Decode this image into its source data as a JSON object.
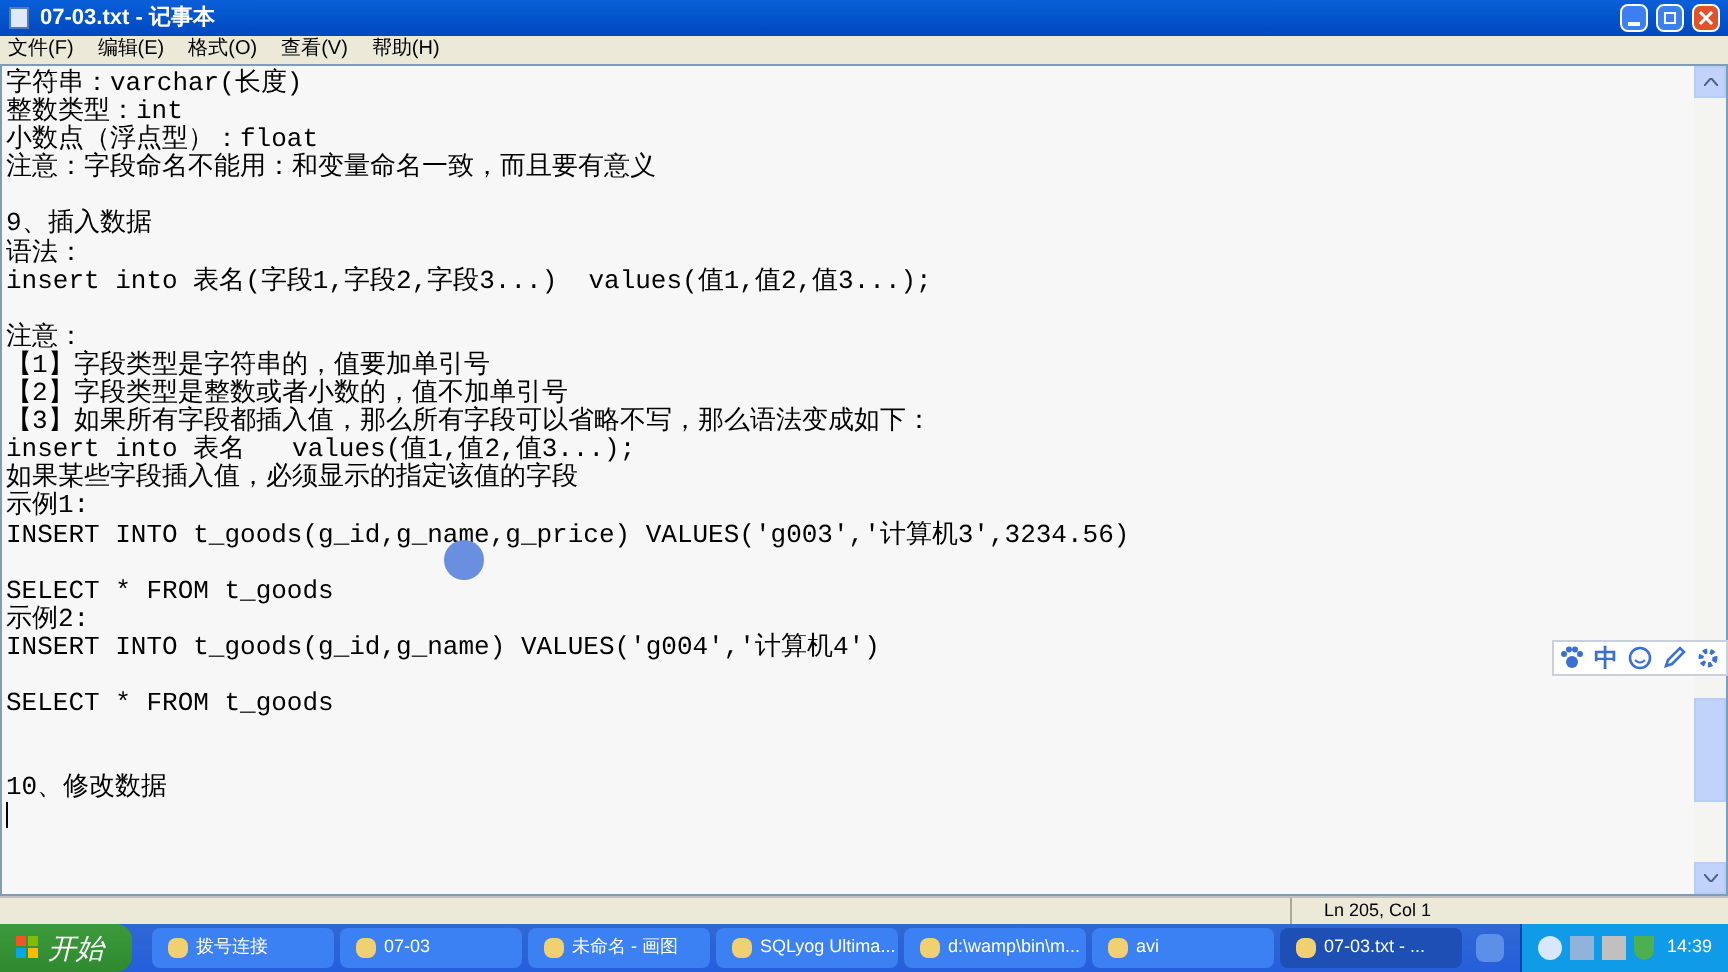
{
  "window": {
    "title": "07-03.txt - 记事本"
  },
  "menu": [
    "文件(F)",
    "编辑(E)",
    "格式(O)",
    "查看(V)",
    "帮助(H)"
  ],
  "lines": [
    {
      "kind": "text",
      "text": "字符串：varchar(长度)"
    },
    {
      "kind": "text",
      "text": "整数类型：int"
    },
    {
      "kind": "text",
      "text": "小数点（浮点型）：float"
    },
    {
      "kind": "text",
      "text": "注意：字段命名不能用：和变量命名一致，而且要有意义"
    },
    {
      "kind": "blank"
    },
    {
      "kind": "text",
      "text": "9、插入数据"
    },
    {
      "kind": "text",
      "text": "语法："
    },
    {
      "kind": "text",
      "text": "insert into 表名(字段1,字段2,字段3...)  values(值1,值2,值3...);"
    },
    {
      "kind": "blank"
    },
    {
      "kind": "text",
      "text": "注意："
    },
    {
      "kind": "text",
      "text": "【1】字段类型是字符串的，值要加单引号"
    },
    {
      "kind": "text",
      "text": "【2】字段类型是整数或者小数的，值不加单引号"
    },
    {
      "kind": "text",
      "text": "【3】如果所有字段都插入值，那么所有字段可以省略不写，那么语法变成如下："
    },
    {
      "kind": "text",
      "text": "insert into 表名   values(值1,值2,值3...);"
    },
    {
      "kind": "text",
      "text": "如果某些字段插入值，必须显示的指定该值的字段"
    },
    {
      "kind": "text",
      "text": "示例1:"
    },
    {
      "kind": "text",
      "text": "INSERT INTO t_goods(g_id,g_name,g_price) VALUES('g003','计算机3',3234.56)"
    },
    {
      "kind": "blank"
    },
    {
      "kind": "text",
      "text": "SELECT * FROM t_goods"
    },
    {
      "kind": "text",
      "text": "示例2:"
    },
    {
      "kind": "text",
      "text": "INSERT INTO t_goods(g_id,g_name) VALUES('g004','计算机4')"
    },
    {
      "kind": "blank"
    },
    {
      "kind": "text",
      "text": "SELECT * FROM t_goods"
    },
    {
      "kind": "blank"
    },
    {
      "kind": "blank"
    },
    {
      "kind": "text",
      "text": "10、修改数据"
    },
    {
      "kind": "caret"
    }
  ],
  "ime_toolbar": {
    "label": "中"
  },
  "status_bar": {
    "position": "Ln 205, Col 1"
  },
  "taskbar": {
    "start": "开始",
    "tasks": [
      {
        "label": "拨号连接",
        "selected": false
      },
      {
        "label": "07-03",
        "selected": false
      },
      {
        "label": "未命名 - 画图",
        "selected": false
      },
      {
        "label": "SQLyog Ultima...",
        "selected": false
      },
      {
        "label": "d:\\wamp\\bin\\m...",
        "selected": false
      },
      {
        "label": "avi",
        "selected": false
      },
      {
        "label": "07-03.txt - ...",
        "selected": true
      }
    ],
    "clock": "14:39"
  }
}
